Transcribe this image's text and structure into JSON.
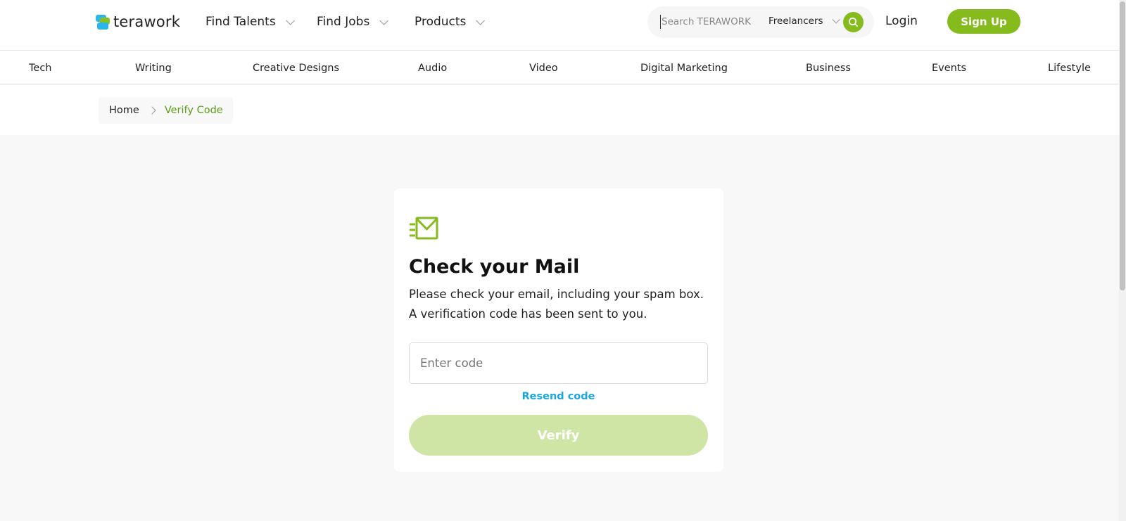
{
  "header": {
    "logo_text": "terawork",
    "nav": [
      {
        "label": "Find Talents"
      },
      {
        "label": "Find Jobs"
      },
      {
        "label": "Products"
      }
    ],
    "search": {
      "placeholder": "Search TERAWORK",
      "scope": "Freelancers"
    },
    "login_label": "Login",
    "signup_label": "Sign Up"
  },
  "categories": [
    "Tech",
    "Writing",
    "Creative Designs",
    "Audio",
    "Video",
    "Digital Marketing",
    "Business",
    "Events",
    "Lifestyle"
  ],
  "breadcrumb": {
    "home": "Home",
    "current": "Verify Code"
  },
  "card": {
    "title": "Check your Mail",
    "description": "Please check your email, including your spam box. A verification code has been sent to you.",
    "code_placeholder": "Enter code",
    "resend_label": "Resend code",
    "verify_label": "Verify"
  },
  "colors": {
    "brand_green": "#86bb1e",
    "brand_blue": "#2bb5e8",
    "link_blue": "#1aa7e0",
    "verify_disabled": "#cfe5a6",
    "breadcrumb_active": "#5a9d14"
  },
  "icons": [
    "logo-icon",
    "chevron-down-icon",
    "search-icon",
    "chevron-right-icon",
    "mail-icon"
  ]
}
